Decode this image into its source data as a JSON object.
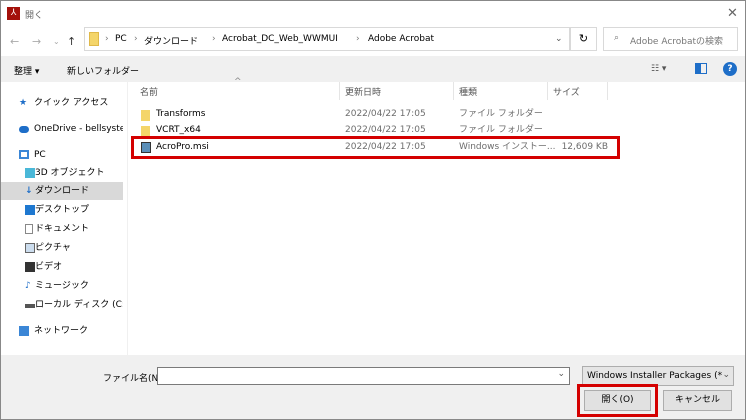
{
  "window": {
    "title": "開く",
    "close": "✕"
  },
  "address": {
    "crumbs": [
      "PC",
      "ダウンロード",
      "Acrobat_DC_Web_WWMUI",
      "Adobe Acrobat"
    ],
    "search_placeholder": "Adobe Acrobatの検索"
  },
  "toolbar": {
    "organize": "整理 ▾",
    "new_folder": "新しいフォルダー",
    "help": "?"
  },
  "sidebar": {
    "items": [
      {
        "label": "クイック アクセス"
      },
      {
        "label": "OneDrive - bellsysten"
      },
      {
        "label": "PC"
      },
      {
        "label": "3D オブジェクト"
      },
      {
        "label": "ダウンロード"
      },
      {
        "label": "デスクトップ"
      },
      {
        "label": "ドキュメント"
      },
      {
        "label": "ピクチャ"
      },
      {
        "label": "ビデオ"
      },
      {
        "label": "ミュージック"
      },
      {
        "label": "ローカル ディスク (C:)"
      },
      {
        "label": "ネットワーク"
      }
    ]
  },
  "columns": {
    "name": "名前",
    "date": "更新日時",
    "type": "種類",
    "size": "サイズ"
  },
  "files": [
    {
      "name": "Transforms",
      "date": "2022/04/22 17:05",
      "type": "ファイル フォルダー",
      "size": ""
    },
    {
      "name": "VCRT_x64",
      "date": "2022/04/22 17:05",
      "type": "ファイル フォルダー",
      "size": ""
    },
    {
      "name": "AcroPro.msi",
      "date": "2022/04/22 17:05",
      "type": "Windows インストー...",
      "size": "12,609 KB"
    }
  ],
  "bottom": {
    "filename_label": "ファイル名(N):",
    "filename_value": "",
    "filter": "Windows Installer Packages (*.r",
    "open": "開く(O)",
    "cancel": "キャンセル"
  },
  "colors": {
    "highlight": "#d40000",
    "accent": "#1e6ec8"
  }
}
